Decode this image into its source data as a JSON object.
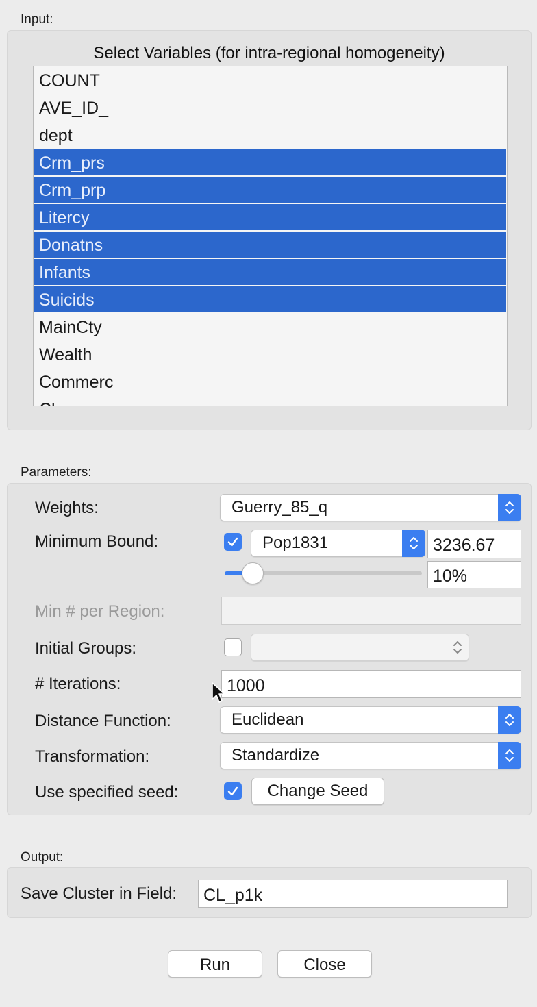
{
  "input": {
    "section_label": "Input:",
    "list_title": "Select Variables (for intra-regional homogeneity)",
    "variables": [
      {
        "label": "COUNT",
        "selected": false
      },
      {
        "label": "AVE_ID_",
        "selected": false
      },
      {
        "label": "dept",
        "selected": false
      },
      {
        "label": "Crm_prs",
        "selected": true
      },
      {
        "label": "Crm_prp",
        "selected": true
      },
      {
        "label": "Litercy",
        "selected": true
      },
      {
        "label": "Donatns",
        "selected": true
      },
      {
        "label": "Infants",
        "selected": true
      },
      {
        "label": "Suicids",
        "selected": true
      },
      {
        "label": "MainCty",
        "selected": false
      },
      {
        "label": "Wealth",
        "selected": false
      },
      {
        "label": "Commerc",
        "selected": false
      },
      {
        "label": "Clergy",
        "selected": false
      }
    ]
  },
  "parameters": {
    "section_label": "Parameters:",
    "weights": {
      "label": "Weights:",
      "value": "Guerry_85_q"
    },
    "minimum_bound": {
      "label": "Minimum Bound:",
      "checked": true,
      "variable": "Pop1831",
      "value": "3236.67",
      "percent_text": "10%",
      "slider_fraction": 0.1
    },
    "min_per_region": {
      "label": "Min # per Region:",
      "value": ""
    },
    "initial_groups": {
      "label": "Initial Groups:",
      "checked": false,
      "value": ""
    },
    "iterations": {
      "label": "# Iterations:",
      "value": "1000"
    },
    "distance_function": {
      "label": "Distance Function:",
      "value": "Euclidean"
    },
    "transformation": {
      "label": "Transformation:",
      "value": "Standardize"
    },
    "seed": {
      "label": "Use specified seed:",
      "checked": true,
      "button_label": "Change Seed"
    }
  },
  "output": {
    "section_label": "Output:",
    "save_label": "Save Cluster in Field:",
    "field_value": "CL_p1k"
  },
  "buttons": {
    "run": "Run",
    "close": "Close"
  },
  "colors": {
    "selection": "#2c67cc",
    "accent": "#3b7ef0"
  }
}
